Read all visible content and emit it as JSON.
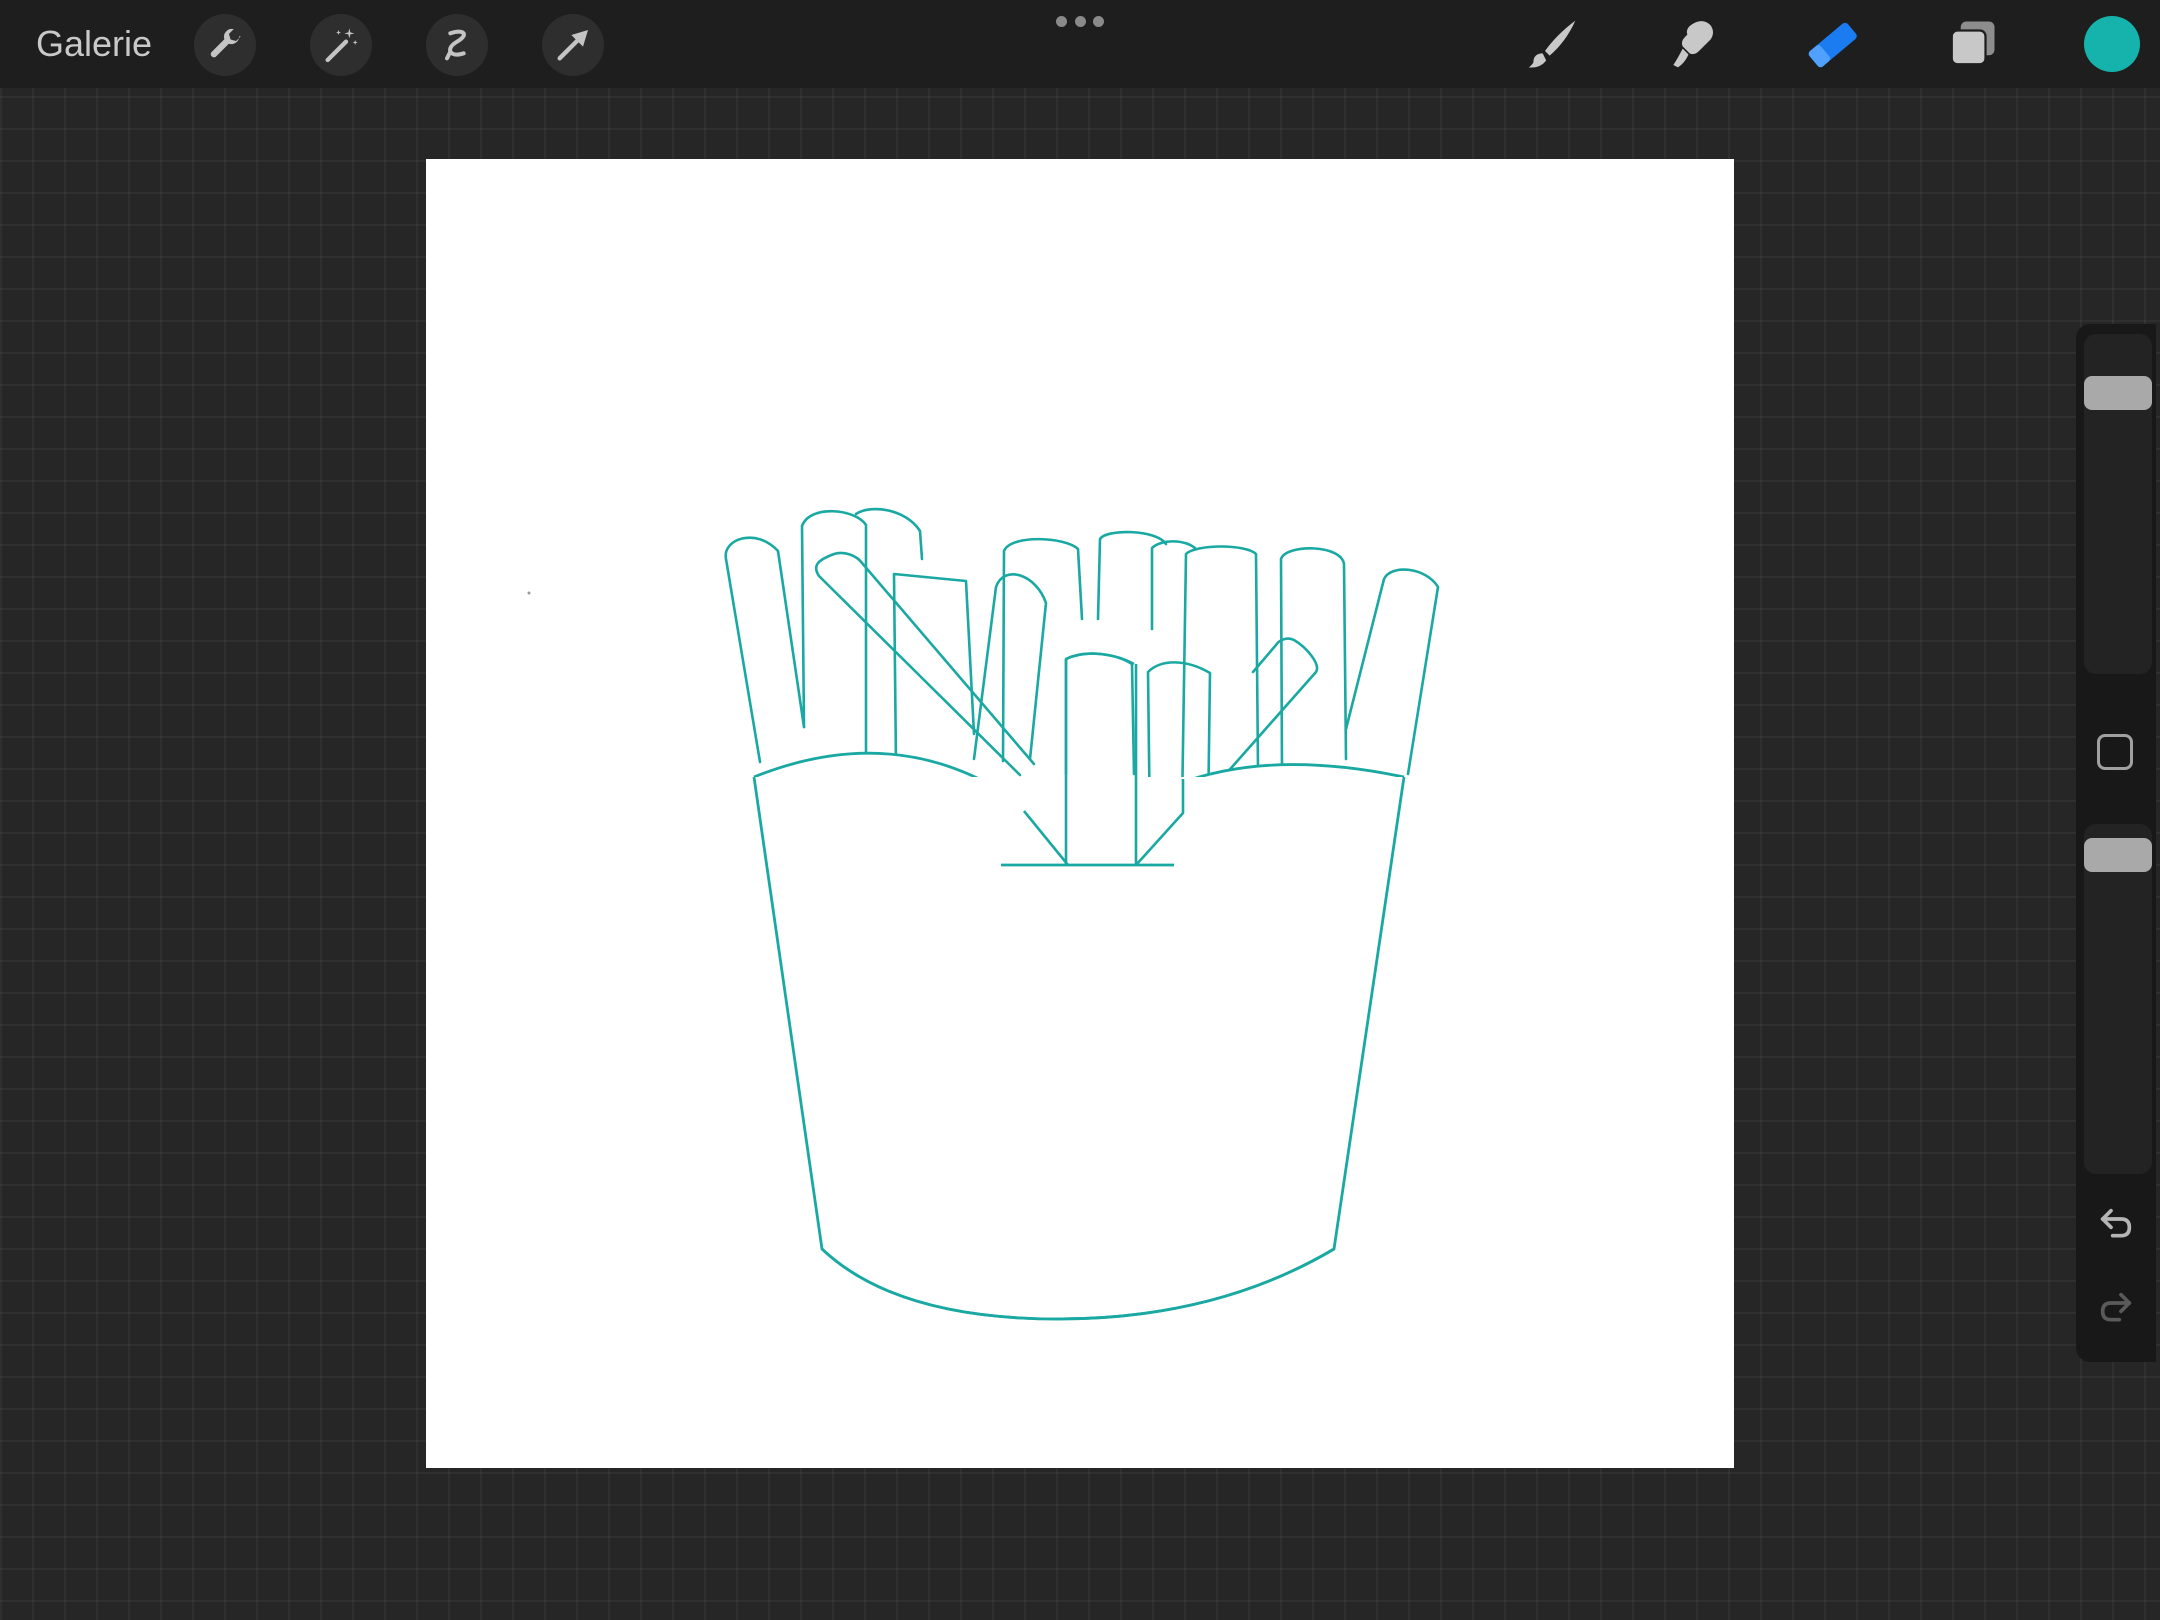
{
  "toolbar": {
    "gallery_label": "Galerie",
    "left_tools": [
      "wrench-icon",
      "magic-wand-icon",
      "selection-icon",
      "transform-arrow-icon"
    ],
    "right_tools": [
      "brush-icon",
      "smudge-icon",
      "eraser-icon",
      "layers-icon"
    ],
    "active_tool": "eraser",
    "active_tool_color": "#1a7cf0",
    "current_color": "#15b3ab"
  },
  "canvas": {
    "background": "#ffffff",
    "drawing_subject": "french-fries-outline",
    "stroke_color": "#1aa8a3"
  },
  "sidebar": {
    "brush_size_level": 0.15,
    "opacity_level": 0.05,
    "icons": [
      "modify-square-icon",
      "undo-icon",
      "redo-icon"
    ]
  }
}
